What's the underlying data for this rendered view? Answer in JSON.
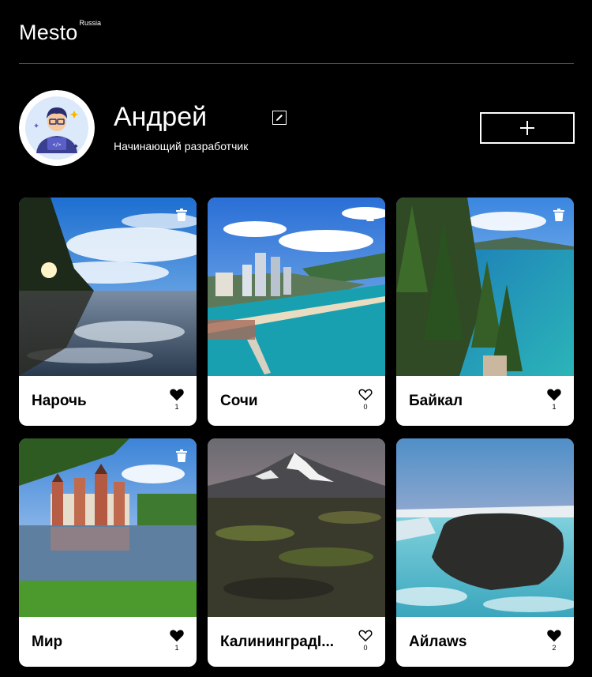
{
  "header": {
    "logo": "Mesto",
    "logo_sup": "Russia"
  },
  "profile": {
    "name": "Андрей",
    "about": "Начинающий разработчик",
    "avatar_icon": "developer-avatar-icon",
    "edit_icon": "pencil-icon",
    "add_icon": "plus-icon"
  },
  "cards": [
    {
      "title": "Нарочь",
      "likes": "1",
      "liked": true,
      "deletable": true,
      "scene": "lake-sunset"
    },
    {
      "title": "Сочи",
      "likes": "0",
      "liked": false,
      "deletable": true,
      "scene": "coastal-city"
    },
    {
      "title": "Байкал",
      "likes": "1",
      "liked": true,
      "deletable": true,
      "scene": "pine-lake"
    },
    {
      "title": "Мир",
      "likes": "1",
      "liked": true,
      "deletable": true,
      "scene": "castle-lake"
    },
    {
      "title": "КалининградI...",
      "likes": "0",
      "liked": false,
      "deletable": false,
      "scene": "volcano"
    },
    {
      "title": "Айлaws",
      "likes": "2",
      "liked": true,
      "deletable": false,
      "scene": "frozen-cliff"
    }
  ],
  "colors": {
    "background": "#000000",
    "card": "#ffffff",
    "text_dark": "#000000"
  }
}
